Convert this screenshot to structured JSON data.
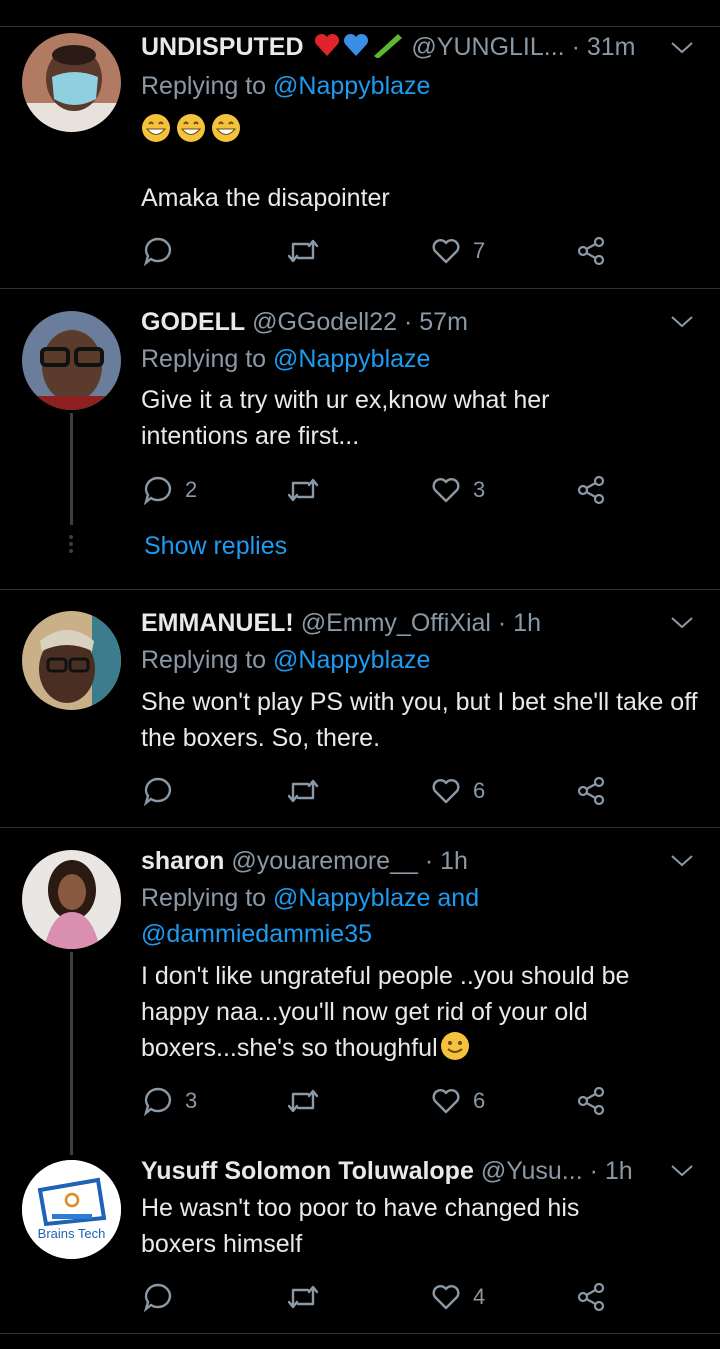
{
  "tweets": [
    {
      "name": "UNDISPUTED",
      "name_emojis": [
        "red-heart-icon",
        "blue-heart-icon",
        "cucumber-icon"
      ],
      "handle": "@YUNGLIL...",
      "time": "· 31m",
      "replying_prefix": "Replying to",
      "replying_to": "@Nappyblaze",
      "body_emojis": [
        "grinning-face-icon",
        "grinning-face-icon",
        "grinning-face-icon"
      ],
      "body": "Amaka the disapointer",
      "counts": {
        "reply": "",
        "retweet": "",
        "like": "7"
      }
    },
    {
      "name": "GODELL",
      "handle": "@GGodell22",
      "time": "· 57m",
      "replying_prefix": "Replying to",
      "replying_to": "@Nappyblaze",
      "body": "Give it a try with ur ex,know what her intentions are first...",
      "counts": {
        "reply": "2",
        "retweet": "",
        "like": "3"
      },
      "show_replies": "Show replies"
    },
    {
      "name": "EMMANUEL!",
      "handle": "@Emmy_OffiXial",
      "time": "· 1h",
      "replying_prefix": "Replying to",
      "replying_to": "@Nappyblaze",
      "body": "She won't play PS with you, but I bet she'll take off the boxers. So, there.",
      "counts": {
        "reply": "",
        "retweet": "",
        "like": "6"
      }
    },
    {
      "name": "sharon",
      "handle": "@youaremore__",
      "time": "· 1h",
      "replying_prefix": "Replying to",
      "replying_to": "@Nappyblaze and",
      "replying_to_2": "@dammiedammie35",
      "body": "I don't like ungrateful people ..you should be happy naa...you'll now get rid of your old boxers...she's so thoughful",
      "body_end_emoji": "slightly-smiling-face-icon",
      "counts": {
        "reply": "3",
        "retweet": "",
        "like": "6"
      }
    },
    {
      "name": "Yusuff Solomon Toluwalope",
      "handle": "@Yusu...",
      "time": "· 1h",
      "body": "He wasn't too poor to have changed his boxers himself",
      "counts": {
        "reply": "",
        "retweet": "",
        "like": "4"
      },
      "avatar_logo_text": "Brains Tech"
    }
  ],
  "colors": {
    "background": "#000000",
    "link": "#1d9bf0",
    "muted": "#8b98a5",
    "divider": "#2f3336"
  }
}
